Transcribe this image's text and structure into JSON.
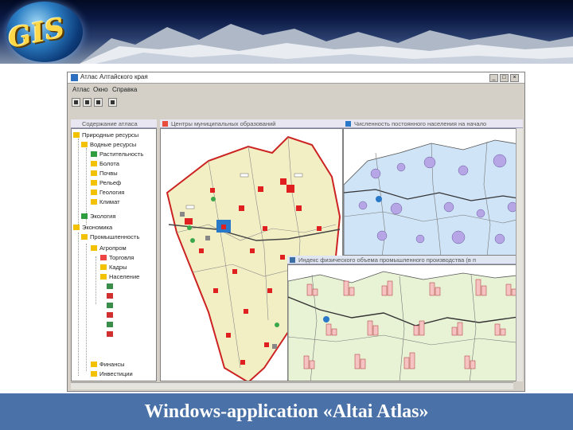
{
  "banner": {
    "logo_text": "GIS"
  },
  "window": {
    "title": "Атлас Алтайского края",
    "menu": [
      "Атлас",
      "Окно",
      "Справка"
    ],
    "buttons": {
      "minimize": "_",
      "maximize": "□",
      "close": "×"
    }
  },
  "panes": {
    "tree_title": "Содержание атласа",
    "map1_title": "Центры муниципальных образований",
    "map2_title": "Численность постоянного населения на начало",
    "map3_title": "Индекс физического объема промышленного производства (в п"
  },
  "tree": {
    "items": [
      {
        "label": "Природные ресурсы",
        "level": 0
      },
      {
        "label": "Водные ресурсы",
        "level": 1
      },
      {
        "label": "Растительность",
        "level": 2
      },
      {
        "label": "Болота",
        "level": 2
      },
      {
        "label": "Почвы",
        "level": 2
      },
      {
        "label": "Рельеф",
        "level": 2
      },
      {
        "label": "Геология",
        "level": 2
      },
      {
        "label": "Климат",
        "level": 2
      },
      {
        "label": "Экология",
        "level": 1
      },
      {
        "label": "Экономика",
        "level": 0
      },
      {
        "label": "Промышленность",
        "level": 1
      },
      {
        "label": "Агропром",
        "level": 2
      },
      {
        "label": "Торговля",
        "level": 3
      },
      {
        "label": "Кадры",
        "level": 3
      },
      {
        "label": "Население",
        "level": 3
      },
      {
        "label": "Финансы",
        "level": 2
      },
      {
        "label": "Инвестиции",
        "level": 2
      }
    ]
  },
  "colors": {
    "banner_top": "#030a22",
    "caption_bg": "#4a72a8",
    "map1_fill": "#f3efc4",
    "map2_fill": "#cfe4f7",
    "map3_fill": "#e8f3d6",
    "marker_red": "#e02020"
  },
  "caption": "Windows-application «Altai Atlas»"
}
